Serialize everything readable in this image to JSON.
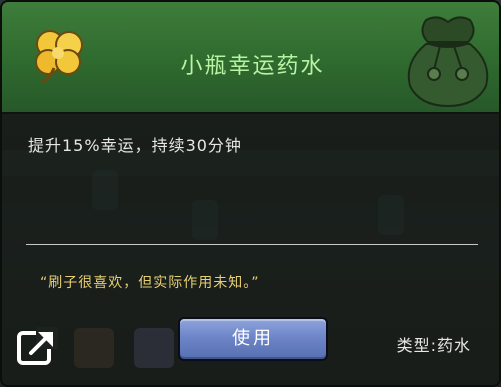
{
  "item": {
    "name": "小瓶幸运药水",
    "description": "提升15%幸运，持续30分钟",
    "flavor_text": "“刷子很喜欢，但实际作用未知。”",
    "type_label": "类型:药水"
  },
  "actions": {
    "use_label": "使用"
  },
  "icons": {
    "item_icon": "four-leaf-clover-icon",
    "background_art": "sack-icon",
    "share": "share-icon"
  },
  "colors": {
    "header_green": "#2f6a2e",
    "title_text": "#b9f3a4",
    "flavor_text": "#e7cf72",
    "button_blue": "#6e86c8"
  }
}
